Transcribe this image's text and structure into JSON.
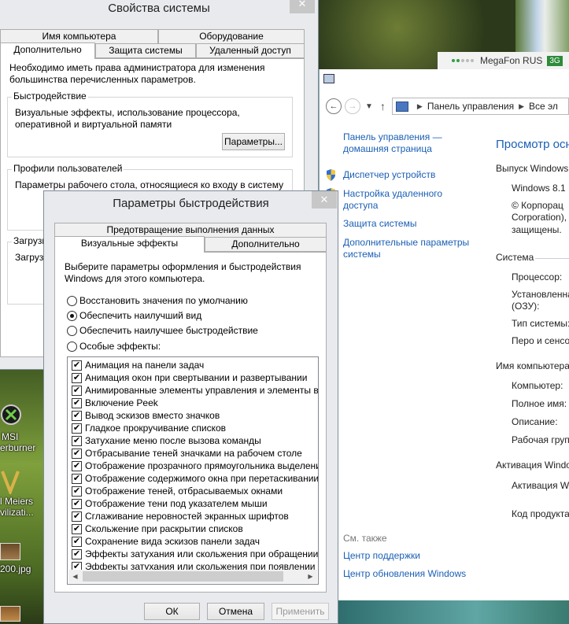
{
  "desktop": {
    "icons": [
      {
        "label": "MSI"
      },
      {
        "label": "erburner"
      },
      {
        "label": "l Meiers"
      },
      {
        "label": "vilizati..."
      },
      {
        "label": "200.jpg"
      }
    ],
    "carrier": {
      "name": "MegaFon RUS",
      "network": "3G"
    }
  },
  "control_panel": {
    "breadcrumb": [
      "Панель управления",
      "Все эл"
    ],
    "sidebar": {
      "home_link": "Панель управления — домашняя страница",
      "links": [
        "Диспетчер устройств",
        "Настройка удаленного доступа",
        "Защита системы",
        "Дополнительные параметры системы"
      ],
      "see_also_heading": "См. также",
      "see_also_links": [
        "Центр поддержки",
        "Центр обновления Windows"
      ]
    },
    "main": {
      "title": "Просмотр осн",
      "edition_heading": "Выпуск Windows",
      "edition_lines": [
        "Windows 8.1 К",
        "© Корпорац",
        "Corporation),",
        "защищены."
      ],
      "system_heading": "Система",
      "system_labels": [
        "Процессор:",
        "Установленна",
        "(ОЗУ):",
        "Тип системы:",
        "Перо и сенсо"
      ],
      "computer_heading": "Имя компьютера",
      "computer_labels": [
        "Компьютер:",
        "Полное имя:",
        "Описание:",
        "Рабочая груп"
      ],
      "activation_heading": "Активация Windo",
      "activation_labels": [
        "Активация Wi",
        "Код продукта"
      ]
    }
  },
  "system_properties": {
    "title": "Свойства системы",
    "tabs_row1": [
      "Имя компьютера",
      "Оборудование"
    ],
    "tabs_row2": [
      "Дополнительно",
      "Защита системы",
      "Удаленный доступ"
    ],
    "admin_note": "Необходимо иметь права администратора для изменения большинства перечисленных параметров.",
    "performance": {
      "label": "Быстродействие",
      "description": "Визуальные эффекты, использование процессора, оперативной и виртуальной памяти",
      "button": "Параметры..."
    },
    "profiles": {
      "label": "Профили пользователей",
      "description": "Параметры рабочего стола, относящиеся ко входу в систему"
    },
    "startup": {
      "label": "Загрузк",
      "description": "Загрузк"
    }
  },
  "performance_options": {
    "title": "Параметры быстродействия",
    "tab_top": "Предотвращение выполнения данных",
    "tabs": [
      "Визуальные эффекты",
      "Дополнительно"
    ],
    "intro": "Выберите параметры оформления и быстродействия Windows для этого компьютера.",
    "radios": [
      {
        "label": "Восстановить значения по умолчанию",
        "checked": false
      },
      {
        "label": "Обеспечить наилучший вид",
        "checked": true
      },
      {
        "label": "Обеспечить наилучшее быстродействие",
        "checked": false
      },
      {
        "label": "Особые эффекты:",
        "checked": false
      }
    ],
    "effects": [
      {
        "label": "Анимация на панели задач",
        "checked": true
      },
      {
        "label": "Анимация окон при свертывании и развертывании",
        "checked": true
      },
      {
        "label": "Анимированные элементы управления и элементы внутри",
        "checked": true
      },
      {
        "label": "Включение Peek",
        "checked": true
      },
      {
        "label": "Вывод эскизов вместо значков",
        "checked": true
      },
      {
        "label": "Гладкое прокручивание списков",
        "checked": true
      },
      {
        "label": "Затухание меню после вызова команды",
        "checked": true
      },
      {
        "label": "Отбрасывание теней значками на рабочем столе",
        "checked": true
      },
      {
        "label": "Отображение прозрачного прямоугольника выделения",
        "checked": true
      },
      {
        "label": "Отображение содержимого окна при перетаскивании",
        "checked": true
      },
      {
        "label": "Отображение теней, отбрасываемых окнами",
        "checked": true
      },
      {
        "label": "Отображение тени под указателем мыши",
        "checked": true
      },
      {
        "label": "Сглаживание неровностей экранных шрифтов",
        "checked": true
      },
      {
        "label": "Скольжение при раскрытии списков",
        "checked": true
      },
      {
        "label": "Сохранение вида эскизов панели задач",
        "checked": true
      },
      {
        "label": "Эффекты затухания или скольжения при обращении к ме",
        "checked": true
      },
      {
        "label": "Эффекты затухания или скольжения при появлении подс",
        "checked": true
      }
    ],
    "buttons": {
      "ok": "ОК",
      "cancel": "Отмена",
      "apply": "Применить"
    }
  }
}
